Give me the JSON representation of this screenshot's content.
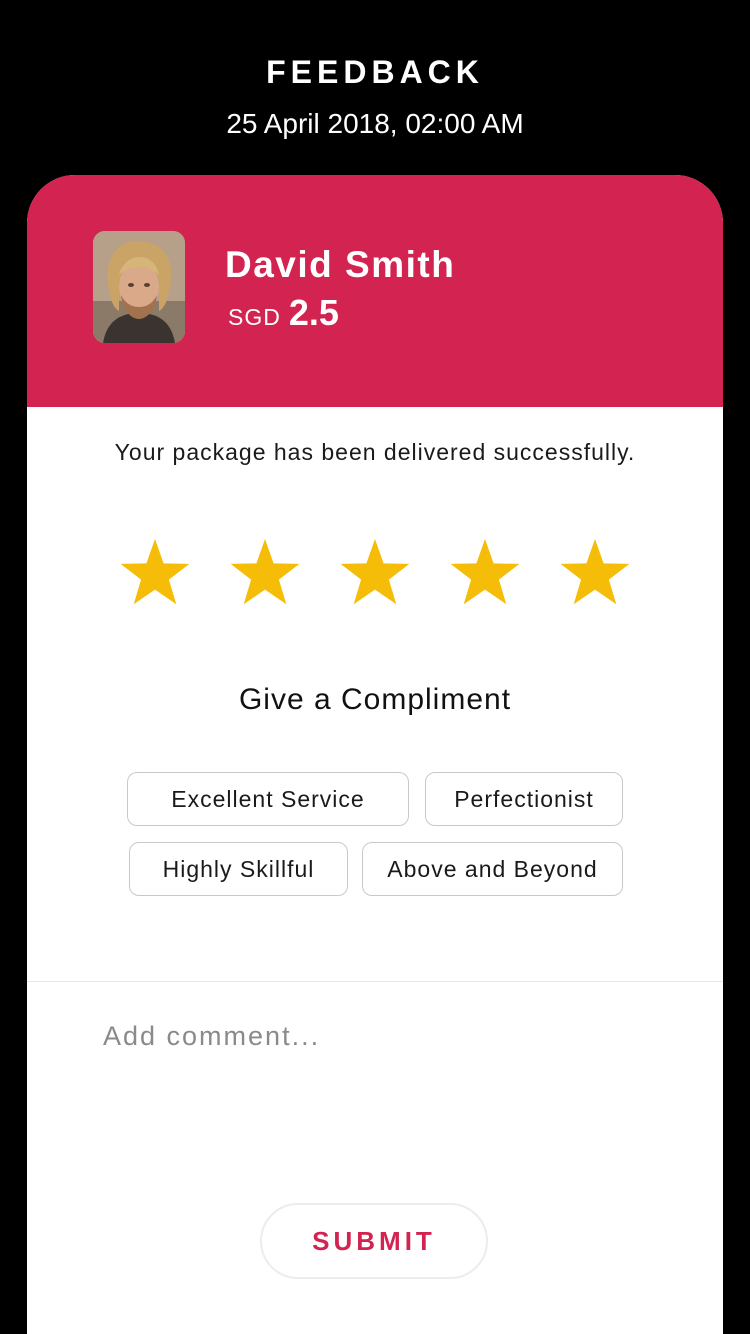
{
  "header": {
    "title": "FEEDBACK",
    "datetime": "25 April 2018, 02:00 AM"
  },
  "driver": {
    "name": "David Smith",
    "currency": "SGD",
    "amount": "2.5",
    "avatar_icon": "driver-photo"
  },
  "message": "Your package has been delivered successfully.",
  "rating": {
    "value": 5,
    "max": 5,
    "star_color": "#f5bd07"
  },
  "compliments": {
    "heading": "Give a Compliment",
    "options": [
      "Excellent  Service",
      "Perfectionist",
      "Highly Skillful",
      "Above and Beyond"
    ]
  },
  "comment": {
    "placeholder": "Add comment...",
    "value": ""
  },
  "submit_label": "SUBMIT",
  "colors": {
    "accent": "#d32350",
    "background": "#000000",
    "card": "#ffffff",
    "star": "#f5bd07"
  }
}
